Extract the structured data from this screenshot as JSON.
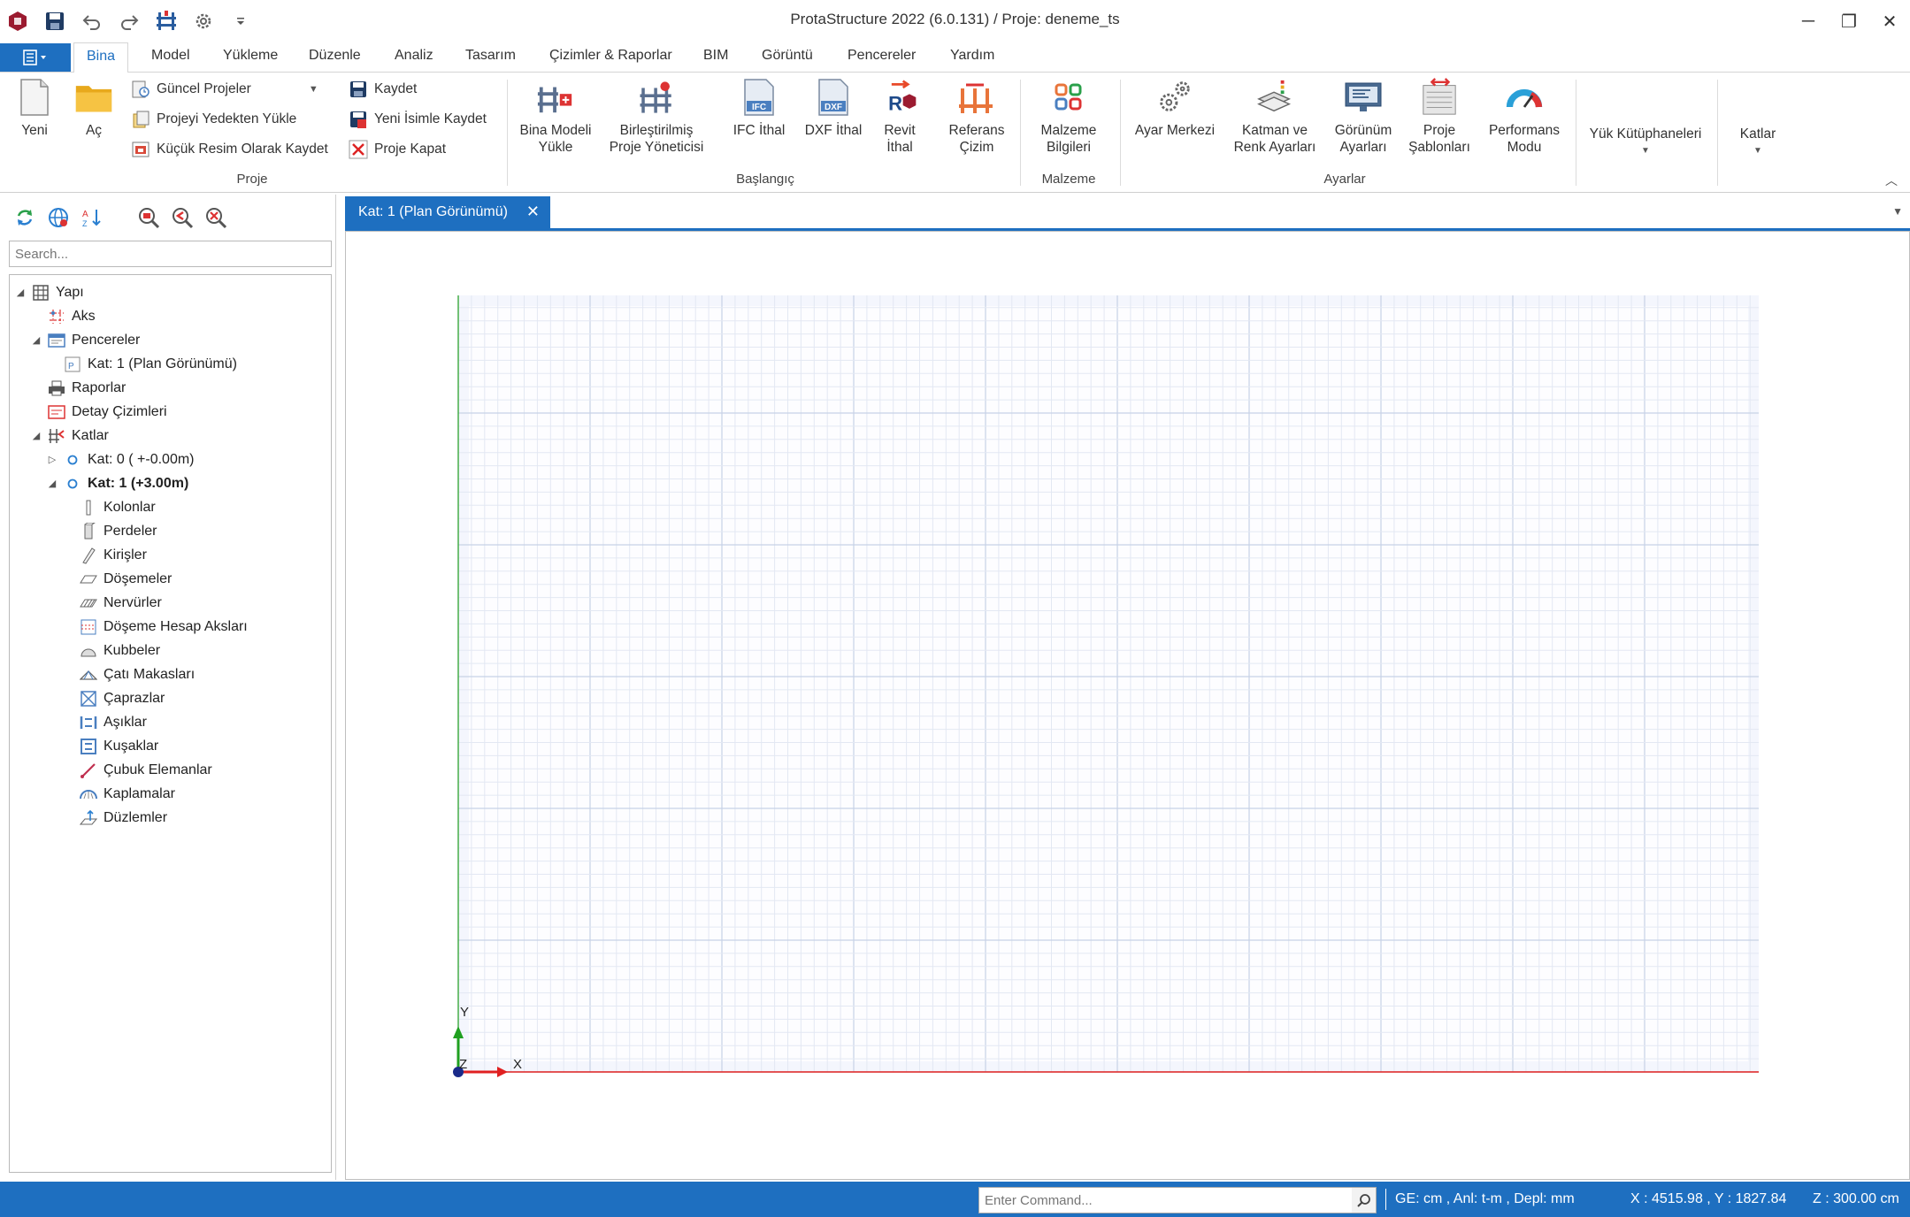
{
  "app": {
    "title": "ProtaStructure 2022 (6.0.131) / Proje: deneme_ts"
  },
  "quick_access": [
    "app-logo-icon",
    "save-icon",
    "undo-icon",
    "redo-icon",
    "structure-icon",
    "settings-icon",
    "customize-dropdown-icon"
  ],
  "window_controls": {
    "minimize": "─",
    "restore": "❐",
    "close": "✕"
  },
  "ribbon_tabs": [
    "Bina",
    "Model",
    "Yükleme",
    "Düzenle",
    "Analiz",
    "Tasarım",
    "Çizimler & Raporlar",
    "BIM",
    "Görüntü",
    "Pencereler",
    "Yardım"
  ],
  "ribbon": {
    "proje": {
      "label": "Proje",
      "yeni": "Yeni",
      "ac": "Aç",
      "guncel": "Güncel Projeler",
      "yedek": "Projeyi Yedekten Yükle",
      "kucuk": "Küçük Resim Olarak Kaydet",
      "kaydet": "Kaydet",
      "yeni_isim": "Yeni İsimle Kaydet",
      "kapat": "Proje Kapat"
    },
    "baslangic": {
      "label": "Başlangıç",
      "bina_modeli": [
        "Bina Modeli",
        "Yükle"
      ],
      "birlestirilmis": [
        "Birleştirilmiş",
        "Proje Yöneticisi"
      ],
      "ifc": [
        "IFC İthal"
      ],
      "dxf": [
        "DXF İthal"
      ],
      "revit": [
        "Revit",
        "İthal"
      ],
      "referans": [
        "Referans",
        "Çizim"
      ]
    },
    "malzeme": {
      "label": "Malzeme",
      "bilgileri": [
        "Malzeme",
        "Bilgileri"
      ]
    },
    "ayarlar": {
      "label": "Ayarlar",
      "ayar_merkezi": [
        "Ayar Merkezi"
      ],
      "katman": [
        "Katman ve",
        "Renk Ayarları"
      ],
      "gorunum": [
        "Görünüm",
        "Ayarları"
      ],
      "sablonlar": [
        "Proje",
        "Şablonları"
      ],
      "performans": [
        "Performans",
        "Modu"
      ]
    },
    "yuk_kutuphaneleri": "Yük Kütüphaneleri",
    "katlar": "Katlar"
  },
  "left_panel": {
    "search_placeholder": "Search...",
    "tree": [
      {
        "label": "Yapı",
        "icon": "structure-icon",
        "level": 0,
        "exp": "◢",
        "bold": false
      },
      {
        "label": "Aks",
        "icon": "axis-icon",
        "level": 1,
        "exp": "",
        "bold": false
      },
      {
        "label": "Pencereler",
        "icon": "windows-icon",
        "level": 1,
        "exp": "◢",
        "bold": false
      },
      {
        "label": "Kat: 1 (Plan Görünümü)",
        "icon": "plan-view-icon",
        "level": 2,
        "exp": "",
        "bold": false
      },
      {
        "label": "Raporlar",
        "icon": "printer-icon",
        "level": 1,
        "exp": "",
        "bold": false
      },
      {
        "label": "Detay Çizimleri",
        "icon": "detail-drawings-icon",
        "level": 1,
        "exp": "",
        "bold": false
      },
      {
        "label": "Katlar",
        "icon": "storeys-icon",
        "level": 1,
        "exp": "◢",
        "bold": false
      },
      {
        "label": "Kat: 0 ( +-0.00m)",
        "icon": "storey-circle-icon",
        "level": 2,
        "exp": "▷",
        "bold": false
      },
      {
        "label": "Kat: 1 (+3.00m)",
        "icon": "storey-circle-icon",
        "level": 2,
        "exp": "◢",
        "bold": true
      },
      {
        "label": "Kolonlar",
        "icon": "column-icon",
        "level": 3,
        "exp": "",
        "bold": false
      },
      {
        "label": "Perdeler",
        "icon": "shear-wall-icon",
        "level": 3,
        "exp": "",
        "bold": false
      },
      {
        "label": "Kirişler",
        "icon": "beam-icon",
        "level": 3,
        "exp": "",
        "bold": false
      },
      {
        "label": "Döşemeler",
        "icon": "slab-icon",
        "level": 3,
        "exp": "",
        "bold": false
      },
      {
        "label": "Nervürler",
        "icon": "ribbed-slab-icon",
        "level": 3,
        "exp": "",
        "bold": false
      },
      {
        "label": "Döşeme Hesap Aksları",
        "icon": "slab-strip-icon",
        "level": 3,
        "exp": "",
        "bold": false
      },
      {
        "label": "Kubbeler",
        "icon": "dome-icon",
        "level": 3,
        "exp": "",
        "bold": false
      },
      {
        "label": "Çatı Makasları",
        "icon": "roof-truss-icon",
        "level": 3,
        "exp": "",
        "bold": false
      },
      {
        "label": "Çaprazlar",
        "icon": "brace-icon",
        "level": 3,
        "exp": "",
        "bold": false
      },
      {
        "label": "Aşıklar",
        "icon": "purlin-icon",
        "level": 3,
        "exp": "",
        "bold": false
      },
      {
        "label": "Kuşaklar",
        "icon": "girt-icon",
        "level": 3,
        "exp": "",
        "bold": false
      },
      {
        "label": "Çubuk Elemanlar",
        "icon": "bar-element-icon",
        "level": 3,
        "exp": "",
        "bold": false
      },
      {
        "label": "Kaplamalar",
        "icon": "cladding-icon",
        "level": 3,
        "exp": "",
        "bold": false
      },
      {
        "label": "Düzlemler",
        "icon": "plane-icon",
        "level": 3,
        "exp": "",
        "bold": false
      }
    ]
  },
  "doc_tab": {
    "label": "Kat: 1 (Plan Görünümü)",
    "close": "✕"
  },
  "viewport": {
    "axis_x": "X",
    "axis_y": "Y",
    "axis_z": "Z"
  },
  "status": {
    "command_placeholder": "Enter Command...",
    "units": "GE: cm , Anl: t-m , Depl: mm",
    "coords": "X : 4515.98 , Y : 1827.84",
    "z": "Z : 300.00 cm"
  },
  "colors": {
    "accent": "#1e6fc0",
    "grid_minor": "#e3e8f3",
    "grid_major": "#c7d2e6",
    "x_axis": "#e02020",
    "y_axis": "#20a020"
  }
}
